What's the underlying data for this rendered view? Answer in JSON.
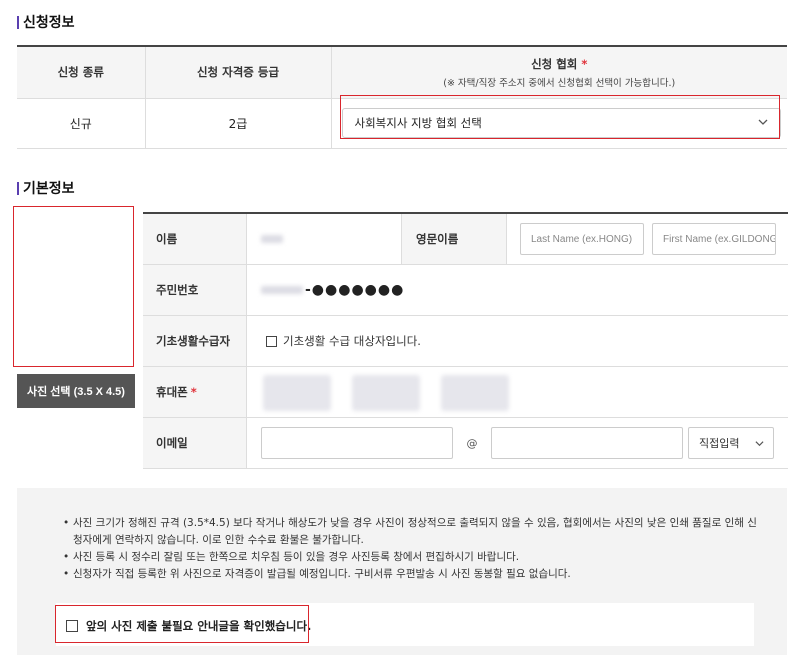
{
  "apply_section": {
    "title": "신청정보",
    "headers": {
      "type": "신청 종류",
      "grade": "신청 자격증 등급",
      "assoc": "신청 협회",
      "assoc_required": "*",
      "assoc_note": "(※ 자택/직장 주소지 중에서 신청협회 선택이 가능합니다.)"
    },
    "row": {
      "type": "신규",
      "grade": "2급",
      "assoc_select": "사회복지사 지방 협회 선택"
    }
  },
  "basic_section": {
    "title": "기본정보",
    "photo_button": "사진 선택 (3.5 X 4.5)",
    "name_label": "이름",
    "eng_name_label": "영문이름",
    "last_name_placeholder": "Last Name (ex.HONG)",
    "first_name_placeholder": "First Name (ex.GILDONG)",
    "ssn_label": "주민번호",
    "ssn_masked": "-●●●●●●●",
    "welfare_label": "기초생활수급자",
    "welfare_checkbox": "기초생활 수급 대상자입니다.",
    "phone_label": "휴대폰",
    "phone_required": "*",
    "email_label": "이메일",
    "email_at": "@",
    "email_domain_select": "직접입력"
  },
  "notice": {
    "items": [
      "사진 크기가 정해진 규격 (3.5*4.5) 보다 작거나 해상도가 낮을 경우 사진이 정상적으로 출력되지 않을 수 있음, 협회에서는 사진의 낮은 인쇄 품질로 인해 신청자에게 연락하지 않습니다. 이로 인한 수수료 환불은 불가합니다.",
      "사진 등록 시 정수리 잘림 또는 한쪽으로 치우침 등이 있을 경우 사진등록 창에서 편집하시기 바랍니다.",
      "신청자가 직접 등록한 위 사진으로 자격증이 발급될 예정입니다. 구비서류 우편발송 시 사진 동봉할 필요 없습니다."
    ],
    "agree_checkbox": "앞의 사진 제출 불필요 안내글을 확인했습니다."
  },
  "colors": {
    "accent": "#5a3fb0",
    "highlight": "#d9262d",
    "required": "#e0323a"
  }
}
